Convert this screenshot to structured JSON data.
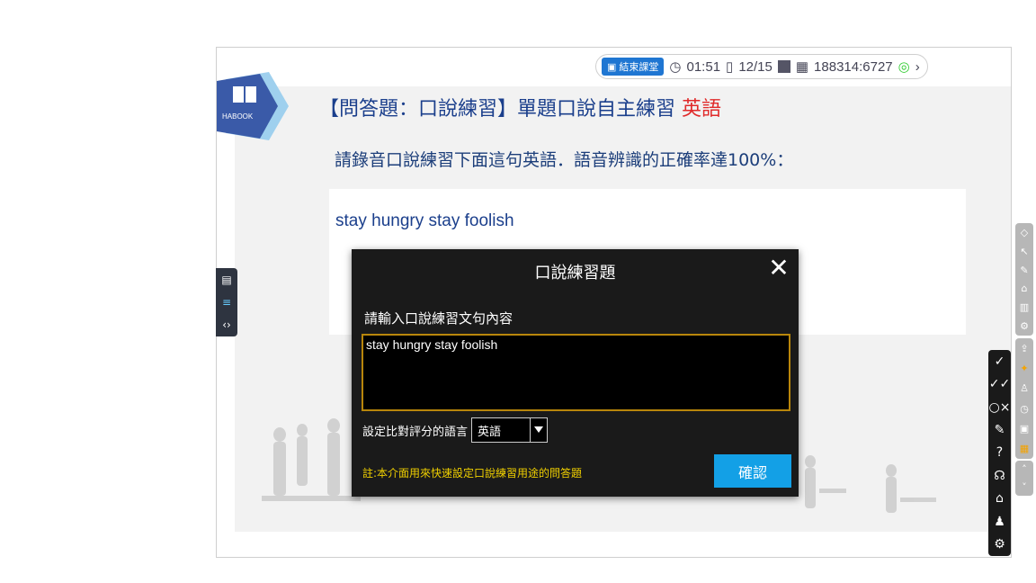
{
  "topbar": {
    "end_class_label": "結束課堂",
    "timer": "01:51",
    "page": "12/15",
    "code": "188314:6727"
  },
  "logo": {
    "text": "HABOOK"
  },
  "slide": {
    "title_main": "【問答題：口說練習】單題口說自主練習",
    "title_lang": "英語",
    "instruction": "請錄音口說練習下面這句英語．語音辨識的正確率達100%：",
    "sentence": "stay hungry stay foolish"
  },
  "dialog": {
    "title": "口說練習題",
    "input_label": "請輸入口說練習文句內容",
    "input_value": "stay hungry stay foolish",
    "language_label": "設定比對評分的語言",
    "language_value": "英語",
    "note": "註:本介面用來快速設定口說練習用途的問答題",
    "confirm_label": "確認"
  },
  "colors": {
    "accent_blue": "#1f76d2",
    "title_blue": "#1b3f8c",
    "lang_red": "#e02a2a",
    "confirm_blue": "#13a0e6",
    "note_yellow": "#f0d000"
  }
}
